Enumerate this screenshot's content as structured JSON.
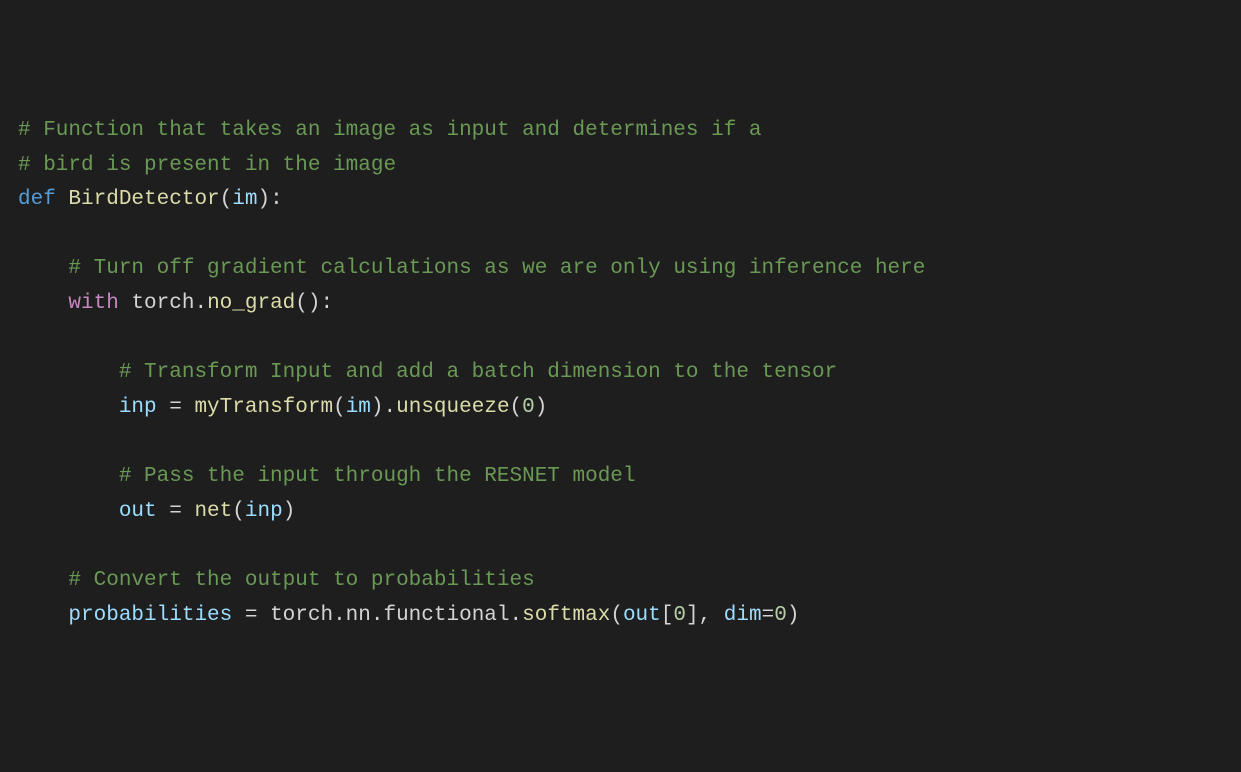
{
  "code": {
    "c1": "# Function that takes an image as input and determines if a",
    "c2": "# bird is present in the image",
    "def": "def",
    "funcname": "BirdDetector",
    "lp1": "(",
    "param": "im",
    "rp1": "):",
    "c3": "# Turn off gradient calculations as we are only using inference here",
    "with": "with",
    "torch1": " torch.",
    "nograd": "no_grad",
    "parens1": "():",
    "c4": "# Transform Input and add a batch dimension to the tensor",
    "inp": "inp",
    "eq1": " = ",
    "mytrans": "myTransform",
    "lp2": "(",
    "im2": "im",
    "rp2": ").",
    "unsq": "unsqueeze",
    "lp3": "(",
    "zero1": "0",
    "rp3": ")",
    "c5": "# Pass the input through the RESNET model",
    "out": "out",
    "eq2": " = ",
    "net": "net",
    "lp4": "(",
    "inp2": "inp",
    "rp4": ")",
    "c6": "# Convert the output to probabilities",
    "prob": "probabilities",
    "eq3": " = ",
    "torchnn": "torch.nn.functional.",
    "softmax": "softmax",
    "lp5": "(",
    "out2": "out",
    "br1": "[",
    "zero2": "0",
    "br2": "], ",
    "dim": "dim",
    "eq4": "=",
    "zero3": "0",
    "rp5": ")"
  }
}
